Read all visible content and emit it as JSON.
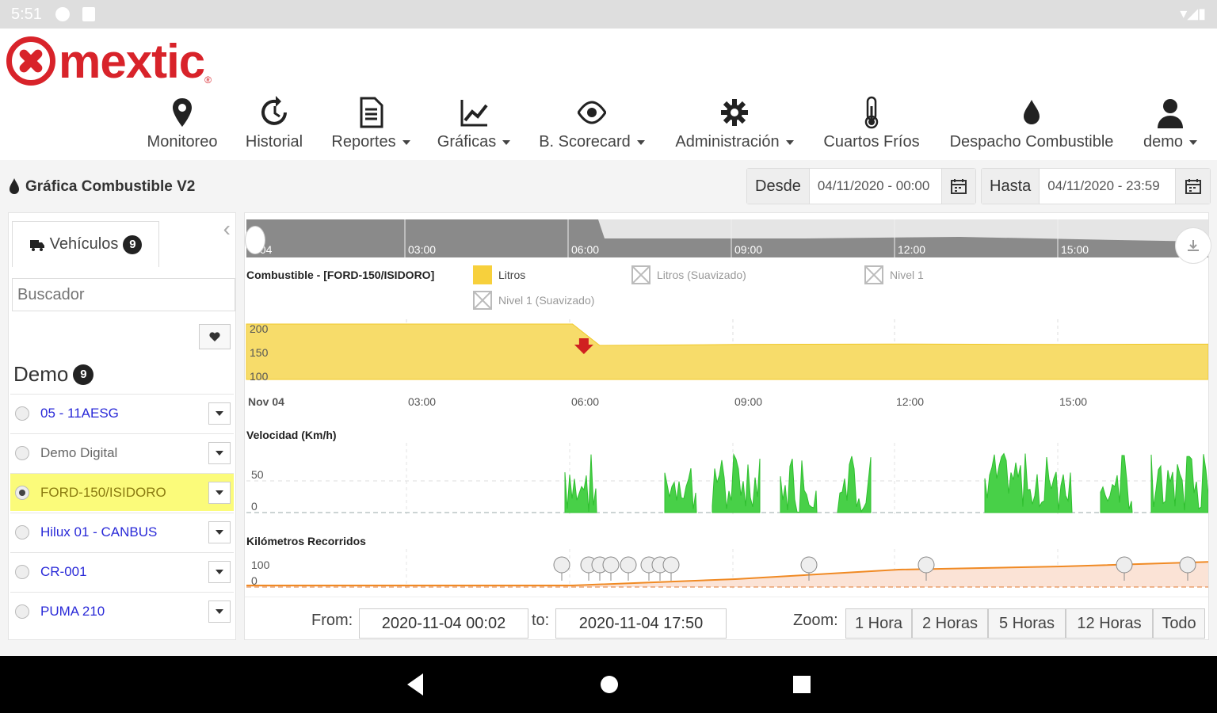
{
  "status_bar": {
    "time": "5:51"
  },
  "brand": {
    "name": "mextic",
    "reg": "®",
    "color": "#d8232a"
  },
  "menu": [
    {
      "label": "Monitoreo",
      "icon": "map-pin-icon",
      "caret": false
    },
    {
      "label": "Historial",
      "icon": "history-icon",
      "caret": false
    },
    {
      "label": "Reportes",
      "icon": "document-icon",
      "caret": true
    },
    {
      "label": "Gráficas",
      "icon": "line-chart-icon",
      "caret": true
    },
    {
      "label": "B. Scorecard",
      "icon": "eye-icon",
      "caret": true
    },
    {
      "label": "Administración",
      "icon": "gear-icon",
      "caret": true
    },
    {
      "label": "Cuartos Fríos",
      "icon": "thermometer-icon",
      "caret": false
    },
    {
      "label": "Despacho Combustible",
      "icon": "fuel-drop-icon",
      "caret": false
    },
    {
      "label": "demo",
      "icon": "user-icon",
      "caret": true
    }
  ],
  "page": {
    "title": "Gráfica Combustible V2",
    "desde_label": "Desde",
    "desde_value": "04/11/2020 - 00:00",
    "hasta_label": "Hasta",
    "hasta_value": "04/11/2020 - 23:59"
  },
  "sidebar": {
    "tab_label": "Vehículos",
    "tab_count": "9",
    "search_placeholder": "Buscador",
    "group_name": "Demo",
    "group_count": "9",
    "vehicles": [
      {
        "name": "05 - 11AESG",
        "selected": false
      },
      {
        "name": "Demo Digital",
        "selected": false
      },
      {
        "name": "FORD-150/ISIDORO",
        "selected": true
      },
      {
        "name": "Hilux 01 - CANBUS",
        "selected": false
      },
      {
        "name": "CR-001",
        "selected": false
      },
      {
        "name": "PUMA 210",
        "selected": false
      }
    ]
  },
  "navigator": {
    "labels": [
      "v 04",
      "03:00",
      "06:00",
      "09:00",
      "12:00",
      "15:00"
    ]
  },
  "chart_data": [
    {
      "type": "area",
      "title": "Combustible - [FORD-150/ISIDORO]",
      "legend": [
        {
          "name": "Litros",
          "color": "#f7d03c",
          "visible": true
        },
        {
          "name": "Litros (Suavizado)",
          "visible": false
        },
        {
          "name": "Nivel 1",
          "visible": false
        },
        {
          "name": "Nivel 1 (Suavizado)",
          "visible": false
        }
      ],
      "yticks": [
        "200",
        "150",
        "100"
      ],
      "xticks": [
        "Nov 04",
        "03:00",
        "06:00",
        "09:00",
        "12:00",
        "15:00"
      ],
      "x": [
        "00:00",
        "03:00",
        "06:00",
        "06:30",
        "09:00",
        "12:00",
        "15:00",
        "17:50"
      ],
      "values": [
        200,
        200,
        200,
        155,
        157,
        158,
        157,
        158
      ],
      "ylim": [
        100,
        200
      ],
      "annotation": "drop-arrow at 06:30"
    },
    {
      "type": "area",
      "title": "Velocidad (Km/h)",
      "yticks": [
        "50",
        "0"
      ],
      "color": "#3fd03f",
      "ylim": [
        0,
        85
      ]
    },
    {
      "type": "line",
      "title": "Kilómetros Recorridos",
      "yticks": [
        "100",
        "0"
      ],
      "color": "#f08a24",
      "x": [
        "00:00",
        "06:00",
        "09:00",
        "12:00",
        "15:00",
        "17:50"
      ],
      "values": [
        0,
        0,
        40,
        100,
        120,
        150
      ]
    }
  ],
  "footer": {
    "from_label": "From:",
    "from_value": "2020-11-04 00:02",
    "to_label": "to:",
    "to_value": "2020-11-04 17:50",
    "zoom_label": "Zoom:",
    "zoom_buttons": [
      "1 Hora",
      "2 Horas",
      "5 Horas",
      "12 Horas",
      "Todo"
    ]
  }
}
